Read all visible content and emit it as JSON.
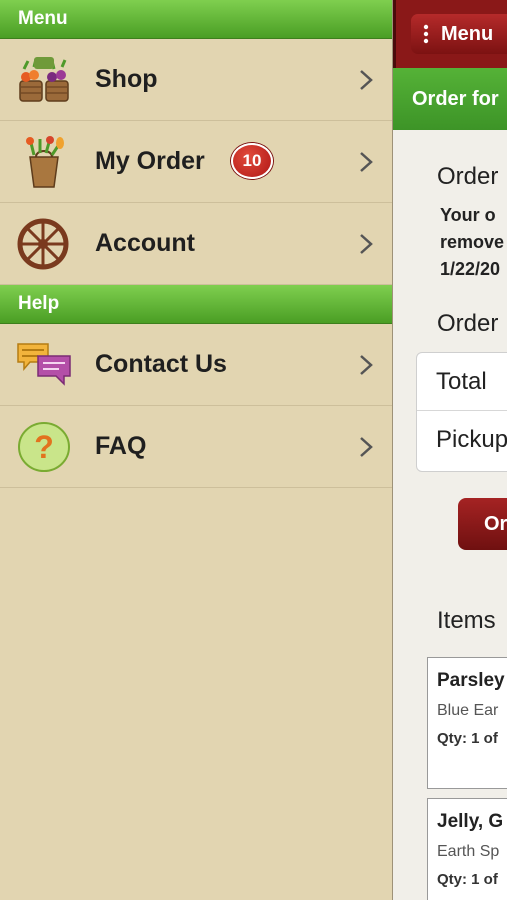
{
  "sidebar": {
    "menu_header": "Menu",
    "help_header": "Help",
    "items": [
      {
        "label": "Shop",
        "icon": "produce-baskets-icon"
      },
      {
        "label": "My Order",
        "icon": "grocery-bag-icon",
        "badge": "10"
      },
      {
        "label": "Account",
        "icon": "wagon-wheel-icon"
      },
      {
        "label": "Contact Us",
        "icon": "chat-bubbles-icon"
      },
      {
        "label": "FAQ",
        "icon": "question-mark-icon"
      }
    ]
  },
  "panel": {
    "menu_button": "Menu",
    "green_bar": "Order for",
    "order_heading": "Order",
    "info_lines": [
      "Your o",
      "remove",
      "1/22/20"
    ],
    "summary_heading": "Order",
    "rows": [
      "Total",
      "Pickup"
    ],
    "button": "Or",
    "items_heading": "Items",
    "items": [
      {
        "name": "Parsley",
        "vendor": "Blue Ear",
        "qty": "Qty: 1 of"
      },
      {
        "name": "Jelly, G",
        "vendor": "Earth Sp",
        "qty": "Qty: 1 of"
      }
    ]
  },
  "colors": {
    "sidebar_bg": "#e2d5b1",
    "header_green": "#5bb52f",
    "topbar_red": "#8a1818",
    "badge_red": "#c21d1d"
  }
}
